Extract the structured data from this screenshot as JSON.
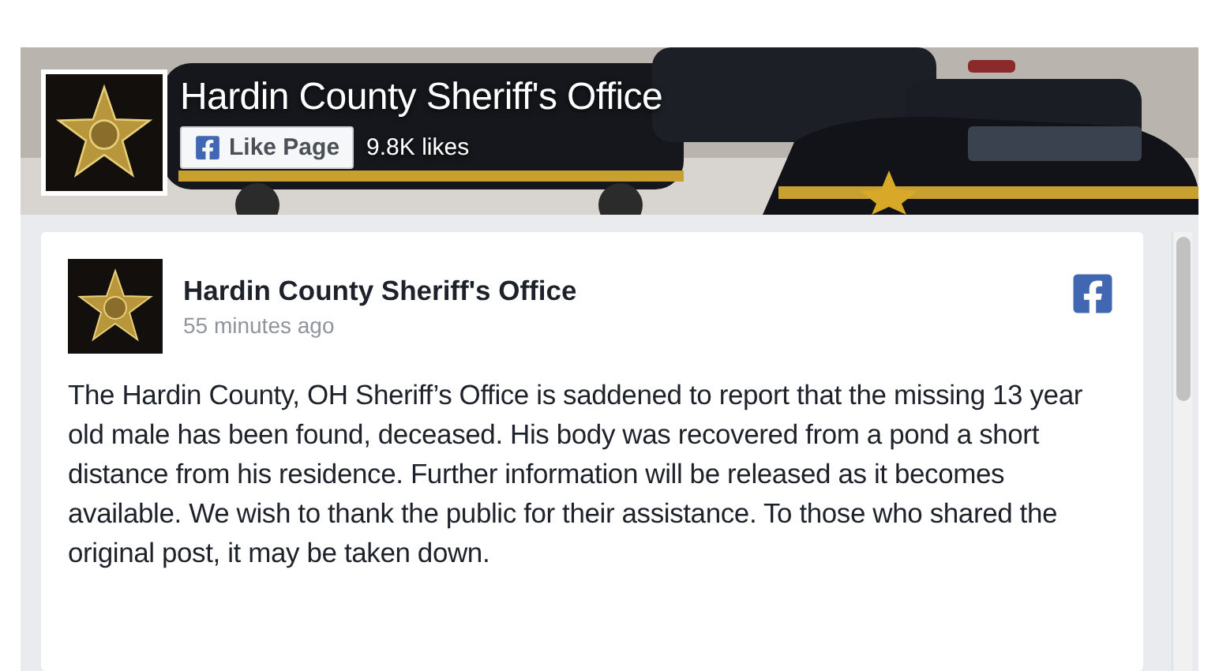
{
  "header": {
    "page_name": "Hardin County Sheriff's Office",
    "like_button": "Like Page",
    "likes": "9.8K likes"
  },
  "post": {
    "author": "Hardin County Sheriff's Office",
    "time": "55 minutes ago",
    "text": "The Hardin County, OH Sheriff’s Office is saddened to report that the missing 13 year old male has been found, deceased. His body was recovered from a pond a short distance from his residence. Further information will be released as it becomes available. We wish to thank the public for their assistance. To those who shared the original post, it may be taken down."
  }
}
